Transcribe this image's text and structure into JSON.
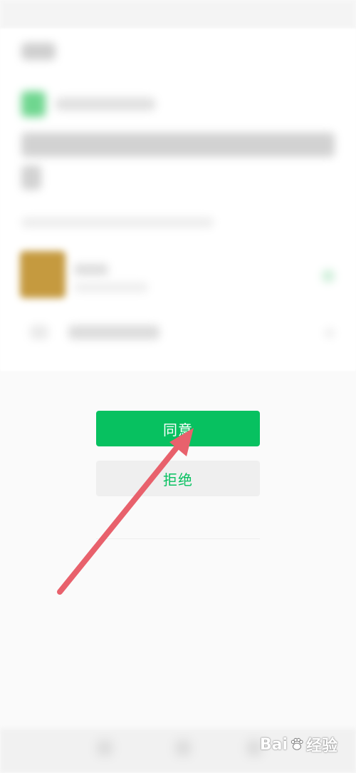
{
  "buttons": {
    "agree_label": "同意",
    "reject_label": "拒绝"
  },
  "watermark": {
    "text_left": "Bai",
    "text_right": "经验"
  },
  "colors": {
    "accent_green": "#07c160",
    "arrow_red": "#e8616c",
    "reject_bg": "#efefef"
  },
  "icons": [
    "avatar-image",
    "status-icon",
    "paw-icon",
    "arrow-annotation"
  ]
}
